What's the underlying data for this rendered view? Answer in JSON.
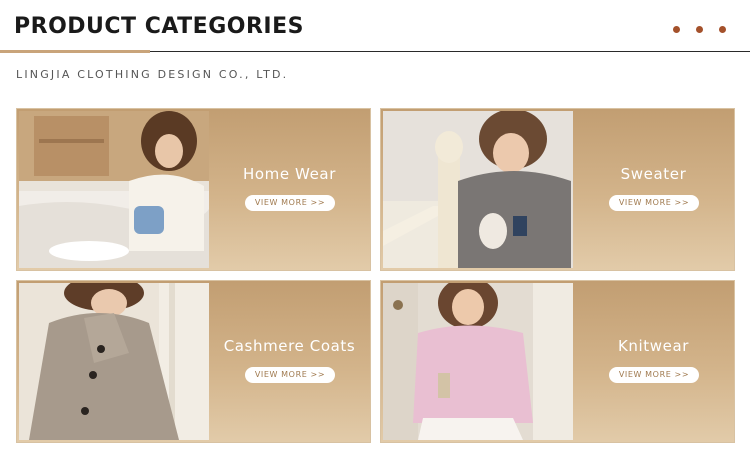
{
  "header": {
    "title": "PRODUCT CATEGORIES",
    "subtitle": "LINGJIA CLOTHING DESIGN CO., LTD.",
    "accent_color": "#c9a47a",
    "dot_color": "#a4512b"
  },
  "categories": [
    {
      "label": "Home Wear",
      "button": "VIEW MORE >>"
    },
    {
      "label": "Sweater",
      "button": "VIEW MORE >>"
    },
    {
      "label": "Cashmere Coats",
      "button": "VIEW MORE >>"
    },
    {
      "label": "Knitwear",
      "button": "VIEW MORE >>"
    }
  ],
  "colors": {
    "card_gradient_top": "#c29e72",
    "card_gradient_bottom": "#e2cba9",
    "button_text": "#a07a4f"
  }
}
